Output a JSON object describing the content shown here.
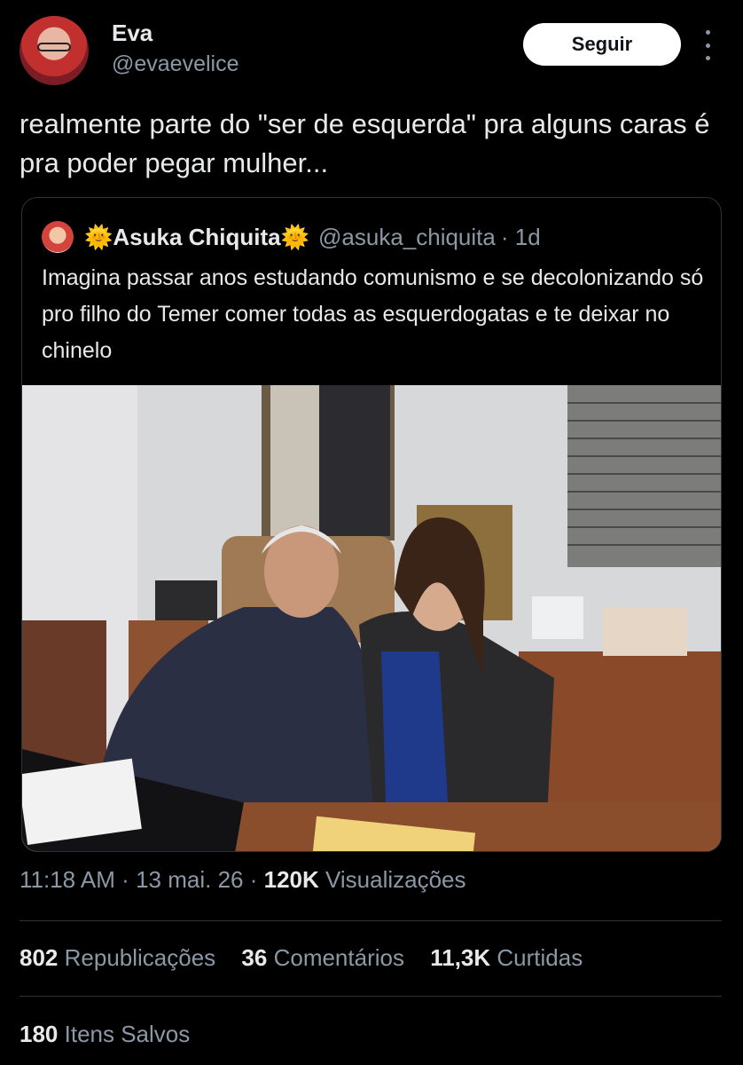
{
  "author": {
    "name": "Eva",
    "handle": "@evaevelice",
    "avatar_icon": "user-avatar"
  },
  "follow_button": {
    "label": "Seguir"
  },
  "more_icon": "more-vertical-icon",
  "tweet": {
    "text": "realmente parte do \"ser de esquerda\" pra alguns caras é pra poder pegar mulher..."
  },
  "quoted": {
    "emoji_left": "🌞",
    "name": "Asuka Chiquita",
    "emoji_right": "🌞",
    "handle": "@asuka_chiquita",
    "time": "· 1d",
    "text": "Imagina passar anos estudando comunismo e se decolonizando só pro filho do Temer comer todas as esquerdogatas e te deixar no chinelo"
  },
  "meta": {
    "time": "11:18 AM",
    "sep1": "·",
    "date": "13 mai. 26",
    "sep2": "·",
    "views_count": "120K",
    "views_label": "Visualizações"
  },
  "stats": {
    "reposts_count": "802",
    "reposts_label": "Republicações",
    "comments_count": "36",
    "comments_label": "Comentários",
    "likes_count": "11,3K",
    "likes_label": "Curtidas"
  },
  "saved": {
    "count": "180",
    "label": "Itens Salvos"
  },
  "colors": {
    "background": "#000000",
    "text": "#e7e9ea",
    "muted": "#8b98a5",
    "divider": "#2f3336"
  }
}
